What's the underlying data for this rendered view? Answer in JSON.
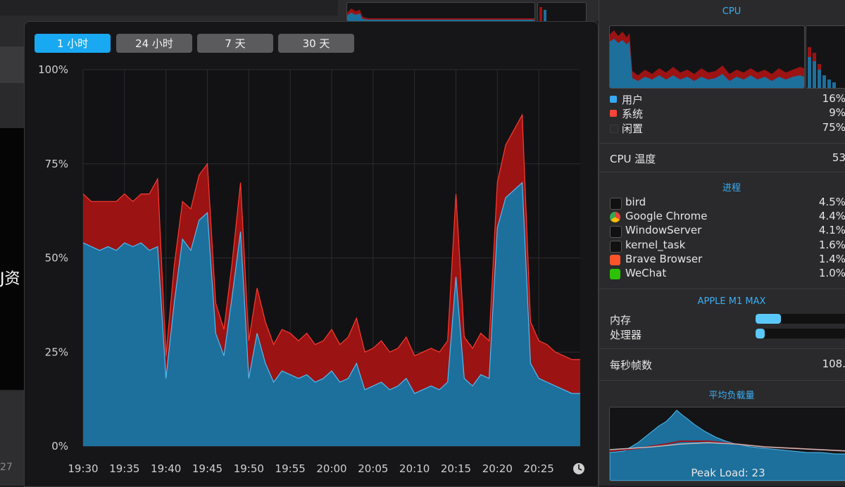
{
  "background": {
    "partial_text": "J资",
    "partial_number": "27"
  },
  "popup": {
    "range_buttons": [
      {
        "label": "1 小时",
        "active": true
      },
      {
        "label": "24 小时",
        "active": false
      },
      {
        "label": "7 天",
        "active": false
      },
      {
        "label": "30 天",
        "active": false
      }
    ],
    "y_ticks": [
      "100%",
      "75%",
      "50%",
      "25%",
      "0%"
    ],
    "x_ticks": [
      "19:30",
      "19:35",
      "19:40",
      "19:45",
      "19:50",
      "19:55",
      "20:00",
      "20:05",
      "20:10",
      "20:15",
      "20:20",
      "20:25"
    ],
    "clock_icon": "clock-icon"
  },
  "chart_data": {
    "type": "area",
    "title": "",
    "xlabel": "",
    "ylabel": "",
    "ylim": [
      0,
      100
    ],
    "x_range": [
      "19:30",
      "20:30"
    ],
    "colors": {
      "user": "#1d6f9c",
      "user_edge": "#4fbdf2",
      "system": "#9b1313",
      "system_edge": "#ff3b30",
      "background": "#121214"
    },
    "x": [
      "19:30",
      "19:31",
      "19:32",
      "19:33",
      "19:34",
      "19:35",
      "19:36",
      "19:37",
      "19:38",
      "19:39",
      "19:40",
      "19:41",
      "19:42",
      "19:43",
      "19:44",
      "19:45",
      "19:46",
      "19:47",
      "19:48",
      "19:49",
      "19:50",
      "19:51",
      "19:52",
      "19:53",
      "19:54",
      "19:55",
      "19:56",
      "19:57",
      "19:58",
      "19:59",
      "20:00",
      "20:01",
      "20:02",
      "20:03",
      "20:04",
      "20:05",
      "20:06",
      "20:07",
      "20:08",
      "20:09",
      "20:10",
      "20:11",
      "20:12",
      "20:13",
      "20:14",
      "20:15",
      "20:16",
      "20:17",
      "20:18",
      "20:19",
      "20:20",
      "20:21",
      "20:22",
      "20:23",
      "20:24",
      "20:25",
      "20:26",
      "20:27",
      "20:28",
      "20:29",
      "20:30"
    ],
    "series": [
      {
        "name": "用户",
        "values": [
          54,
          53,
          52,
          53,
          52,
          54,
          53,
          54,
          52,
          53,
          18,
          38,
          55,
          52,
          60,
          62,
          30,
          24,
          40,
          57,
          18,
          30,
          22,
          17,
          20,
          19,
          18,
          19,
          17,
          18,
          20,
          17,
          18,
          22,
          15,
          16,
          17,
          15,
          16,
          18,
          14,
          15,
          16,
          15,
          17,
          45,
          18,
          16,
          19,
          18,
          58,
          66,
          68,
          70,
          22,
          18,
          17,
          16,
          15,
          14,
          14
        ]
      },
      {
        "name": "系统",
        "values": [
          13,
          12,
          13,
          12,
          13,
          13,
          12,
          13,
          15,
          18,
          6,
          10,
          10,
          11,
          12,
          13,
          8,
          7,
          9,
          13,
          10,
          12,
          11,
          10,
          11,
          11,
          10,
          11,
          10,
          10,
          11,
          10,
          11,
          12,
          10,
          10,
          11,
          10,
          10,
          11,
          10,
          10,
          10,
          10,
          11,
          22,
          11,
          10,
          11,
          10,
          12,
          14,
          16,
          18,
          11,
          10,
          10,
          9,
          9,
          9,
          9
        ]
      }
    ]
  },
  "side": {
    "cpu_title": "CPU",
    "legend": [
      {
        "label": "用户",
        "value": "16%",
        "color": "#35aaf5"
      },
      {
        "label": "系统",
        "value": "9%",
        "color": "#ff453a"
      },
      {
        "label": "闲置",
        "value": "75%",
        "color": "#2c2c2e"
      }
    ],
    "temp_label": "CPU 温度",
    "temp_value": "53",
    "processes_title": "进程",
    "processes": [
      {
        "name": "bird",
        "value": "4.5%",
        "icon": "terminal-icon"
      },
      {
        "name": "Google Chrome",
        "value": "4.4%",
        "icon": "chrome-icon"
      },
      {
        "name": "WindowServer",
        "value": "4.1%",
        "icon": "terminal-icon"
      },
      {
        "name": "kernel_task",
        "value": "1.6%",
        "icon": "terminal-icon"
      },
      {
        "name": "Brave Browser",
        "value": "1.4%",
        "icon": "brave-icon"
      },
      {
        "name": "WeChat",
        "value": "1.0%",
        "icon": "wechat-icon"
      }
    ],
    "gpu_title": "APPLE M1 MAX",
    "gpu_rows": [
      {
        "label": "内存",
        "level": 0.28
      },
      {
        "label": "处理器",
        "level": 0.1
      }
    ],
    "fps_label": "每秒帧数",
    "fps_value": "108.",
    "load_title": "平均负载量",
    "peak_label": "Peak Load: 23"
  }
}
